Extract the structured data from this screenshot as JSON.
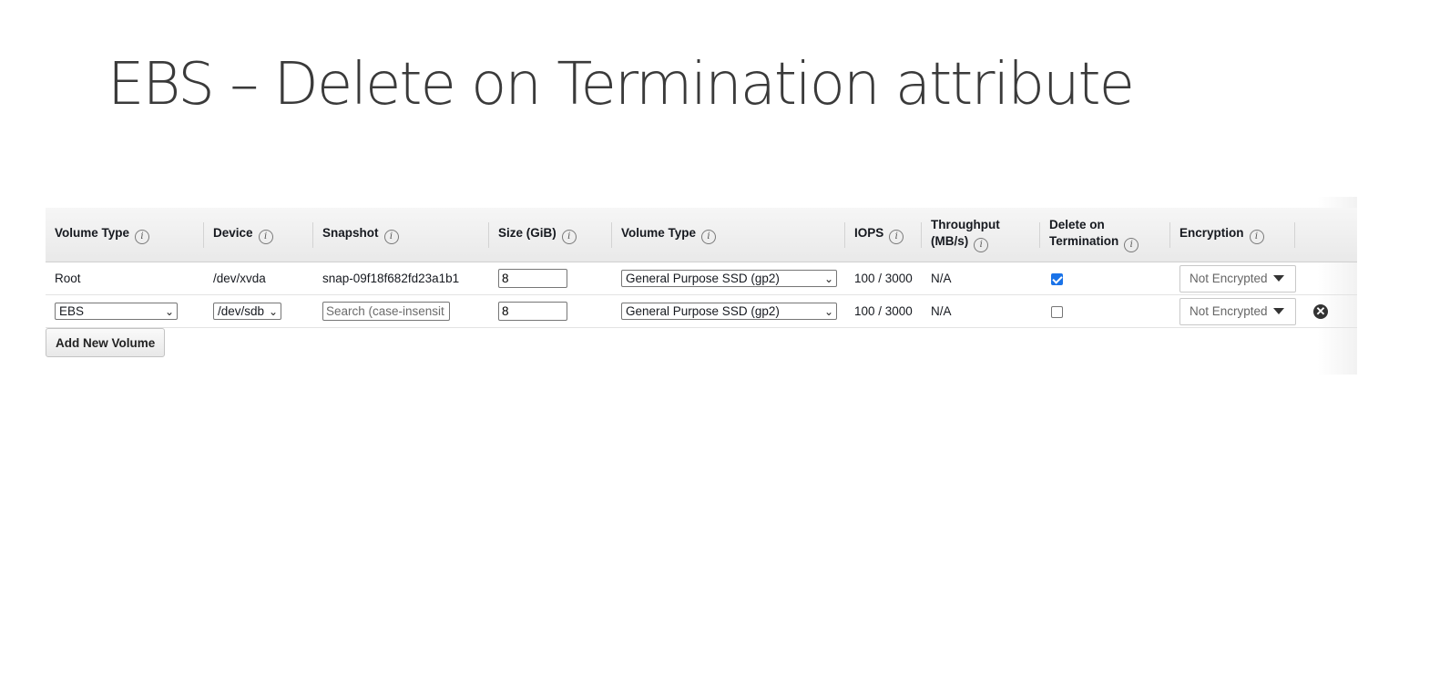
{
  "slide": {
    "title": "EBS – Delete on Termination attribute"
  },
  "table": {
    "headers": {
      "volume_type": "Volume Type",
      "device": "Device",
      "snapshot": "Snapshot",
      "size": "Size (GiB)",
      "volume_type2": "Volume Type",
      "iops": "IOPS",
      "throughput_line1": "Throughput",
      "throughput_line2": "(MB/s)",
      "delete_line1": "Delete on",
      "delete_line2": "Termination",
      "encryption": "Encryption"
    },
    "info_glyph": "i",
    "rows": [
      {
        "volume_type": "Root",
        "device": "/dev/xvda",
        "snapshot": "snap-09f18f682fd23a1b1",
        "size": "8",
        "ebs_type": "General Purpose SSD (gp2)",
        "iops": "100 / 3000",
        "throughput": "N/A",
        "delete_on_termination": true,
        "encryption": "Not Encrypted"
      },
      {
        "volume_type": "EBS",
        "device": "/dev/sdb",
        "snapshot_placeholder": "Search (case-insensit",
        "size": "8",
        "ebs_type": "General Purpose SSD (gp2)",
        "iops": "100 / 3000",
        "throughput": "N/A",
        "delete_on_termination": false,
        "encryption": "Not Encrypted"
      }
    ]
  },
  "add_button_label": "Add New Volume",
  "icons": {
    "remove": "remove-circle-x-icon",
    "remove_glyph": "✕",
    "select_chevron": "⌄"
  },
  "colors": {
    "checkbox_checked": "#1a73e8"
  }
}
